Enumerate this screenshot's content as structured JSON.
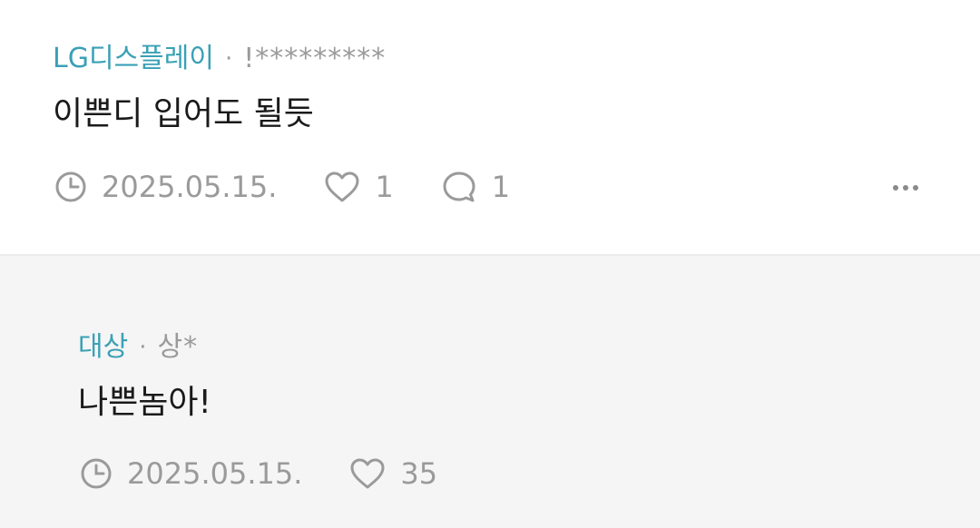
{
  "comment": {
    "author": "LG디스플레이",
    "separator": "·",
    "masked_id": "!*********",
    "text": "이쁜디 입어도 될듯",
    "date": "2025.05.15.",
    "likes": "1",
    "replies": "1",
    "more_icon": "ellipsis-icon"
  },
  "reply": {
    "author": "대상",
    "separator": "·",
    "masked_id": "상*",
    "text": "나쁜놈아!",
    "date": "2025.05.15.",
    "likes": "35"
  },
  "colors": {
    "author": "#3aa0b5",
    "meta": "#9a9a9a",
    "reply_bg": "#f5f5f5",
    "text": "#1a1a1a"
  }
}
